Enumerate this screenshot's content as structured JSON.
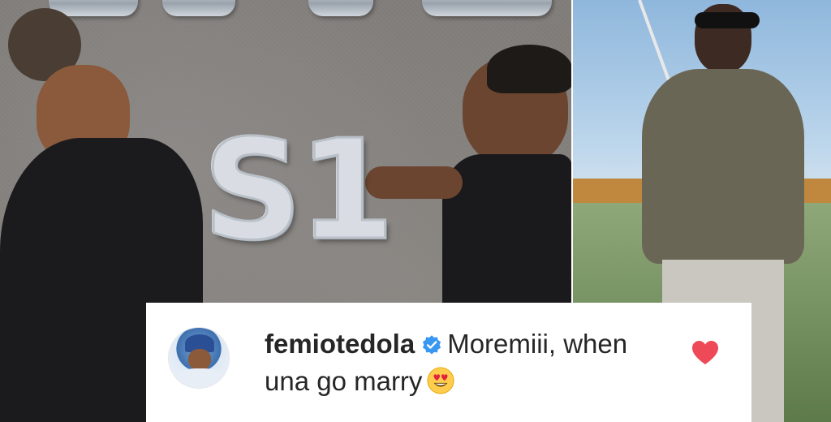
{
  "comment": {
    "username": "femiotedola",
    "text_line1": "Moremiii, when",
    "text_line2": "una go marry",
    "emoji": "heart-eyes-emoji"
  },
  "photo_left": {
    "balloon_letters": [
      "S",
      "1"
    ]
  },
  "colors": {
    "verified_badge": "#3897f0",
    "like_heart": "#ed4956",
    "text": "#262626"
  },
  "icons": {
    "verified": "verified-badge-icon",
    "like": "heart-icon",
    "emoji": "heart-eyes-emoji-icon"
  }
}
